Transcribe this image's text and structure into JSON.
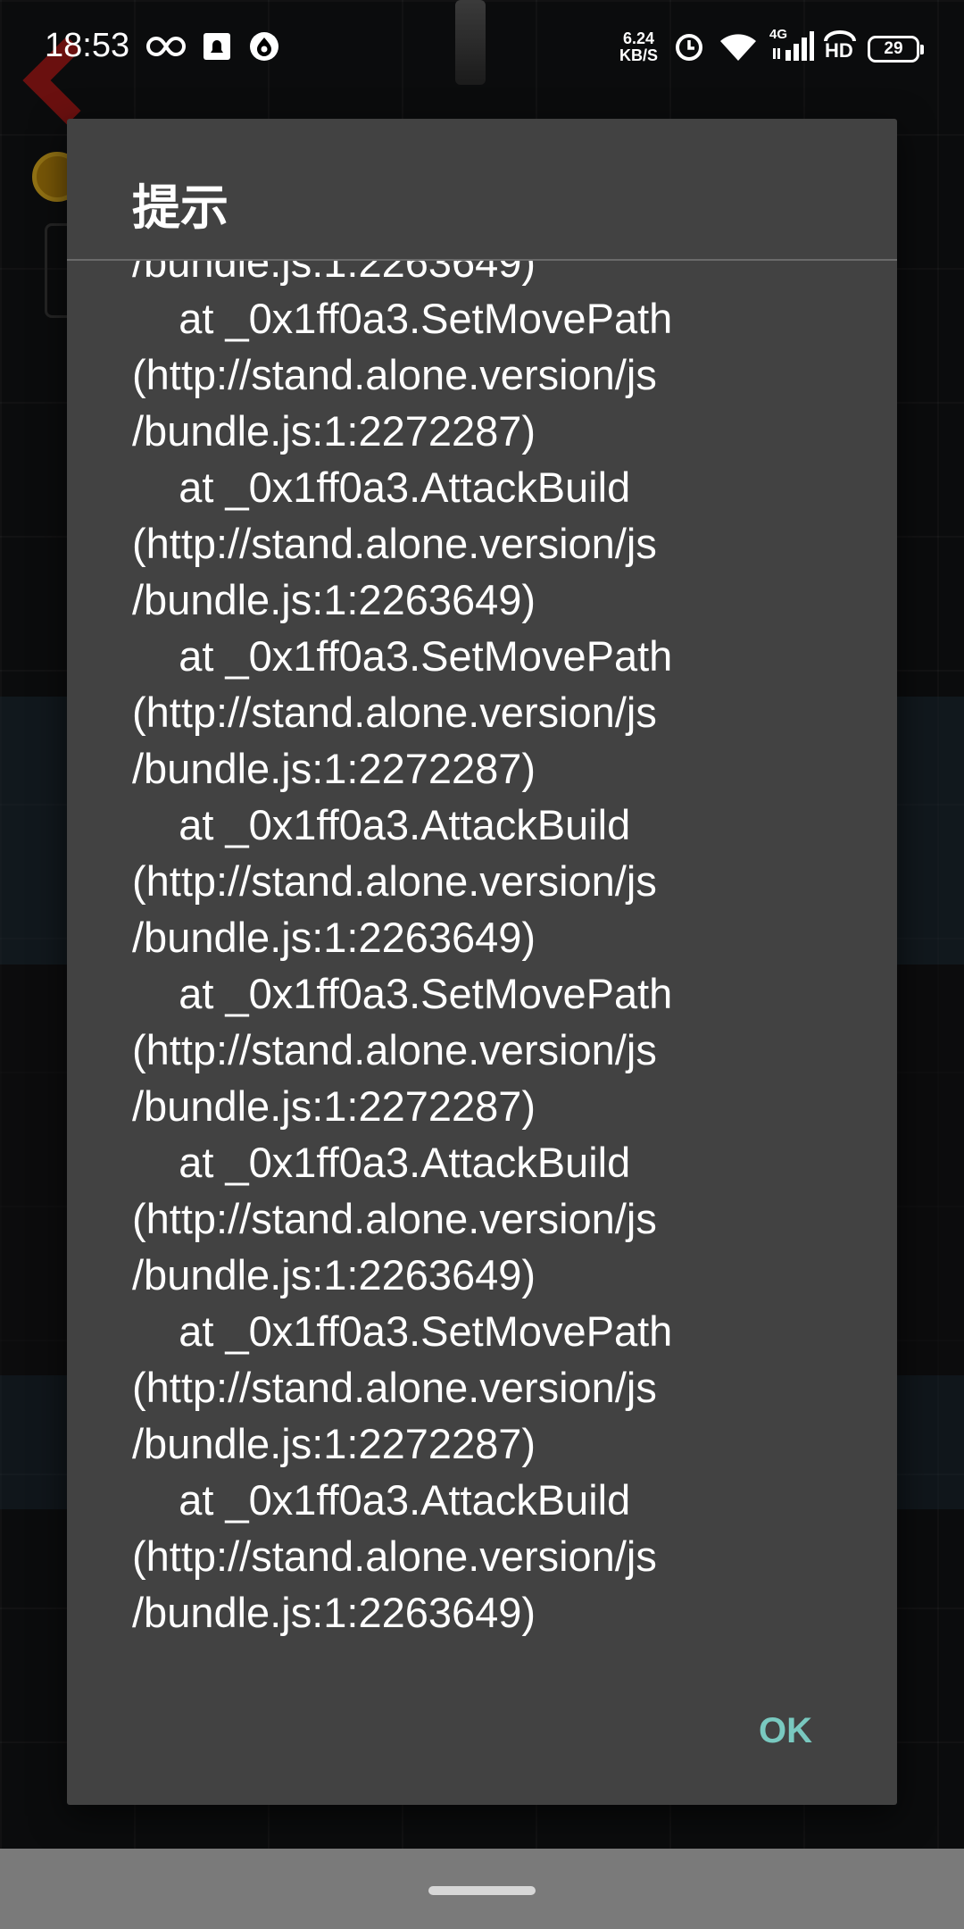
{
  "status_bar": {
    "time": "18:53",
    "net_speed_value": "6.24",
    "net_speed_unit": "KB/S",
    "network_type": "4G",
    "hd_label": "HD",
    "battery_level": "29"
  },
  "dialog": {
    "title": "提示",
    "message": "/bundle.js:1:2263649)\n    at _0x1ff0a3.SetMovePath\n(http://stand.alone.version/js\n/bundle.js:1:2272287)\n    at _0x1ff0a3.AttackBuild\n(http://stand.alone.version/js\n/bundle.js:1:2263649)\n    at _0x1ff0a3.SetMovePath\n(http://stand.alone.version/js\n/bundle.js:1:2272287)\n    at _0x1ff0a3.AttackBuild\n(http://stand.alone.version/js\n/bundle.js:1:2263649)\n    at _0x1ff0a3.SetMovePath\n(http://stand.alone.version/js\n/bundle.js:1:2272287)\n    at _0x1ff0a3.AttackBuild\n(http://stand.alone.version/js\n/bundle.js:1:2263649)\n    at _0x1ff0a3.SetMovePath\n(http://stand.alone.version/js\n/bundle.js:1:2272287)\n    at _0x1ff0a3.AttackBuild\n(http://stand.alone.version/js\n/bundle.js:1:2263649)",
    "ok_label": "OK"
  },
  "colors": {
    "dialog_background": "#424242",
    "button_accent": "#79c9c0",
    "nav_bar": "#7a7a7a"
  },
  "icons": [
    "link-icon",
    "notification-icon",
    "app-icon",
    "alarm-icon",
    "wifi-icon",
    "signal-icon",
    "call-hd-icon",
    "battery-icon",
    "back-arrow-icon",
    "coin-icon"
  ]
}
